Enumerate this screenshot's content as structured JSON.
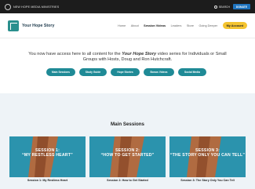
{
  "topbar": {
    "org_name": "NEW HOPE MEDIA MINISTRIES",
    "search_label": "SEARCH",
    "donate_label": "DONATE"
  },
  "header": {
    "brand_name": "Your Hope Story",
    "nav": [
      {
        "label": "Home"
      },
      {
        "label": "About"
      },
      {
        "label": "Session Videos"
      },
      {
        "label": "Leaders"
      },
      {
        "label": "Store"
      },
      {
        "label": "Going Deeper"
      }
    ],
    "account_label": "My Account"
  },
  "intro": {
    "text_before": "You now have access here to all content for the ",
    "series_name": "Your Hope Story",
    "text_after": " video series for Individuals or Small Groups with Hosts, Doug and Ron Hutchcraft.",
    "buttons": [
      {
        "label": "Main Sessions"
      },
      {
        "label": "Study Guide"
      },
      {
        "label": "Hope Stories"
      },
      {
        "label": "Bonus Videos"
      },
      {
        "label": "Social Media"
      }
    ]
  },
  "sessions": {
    "heading": "Main Sessions",
    "items": [
      {
        "title": "SESSION 1:",
        "subtitle": "“MY RESTLESS HEART”",
        "label": "Session 1: My Restless Heart"
      },
      {
        "title": "SESSION 2:",
        "subtitle": "“HOW TO GET STARTED”",
        "label": "Session 2: How to Get Started"
      },
      {
        "title": "SESSION 3:",
        "subtitle": "“THE STORY ONLY YOU CAN TELL”",
        "label": "Session 3: The Story Only You Can Tell"
      }
    ]
  },
  "colors": {
    "accent_teal": "#1f8a96",
    "account_yellow": "#f4c430",
    "donate_blue": "#1e73be",
    "topbar_dark": "#1c1c1c"
  },
  "icons": [
    "logo-circle-icon",
    "search-icon",
    "brand-logo-icon"
  ]
}
